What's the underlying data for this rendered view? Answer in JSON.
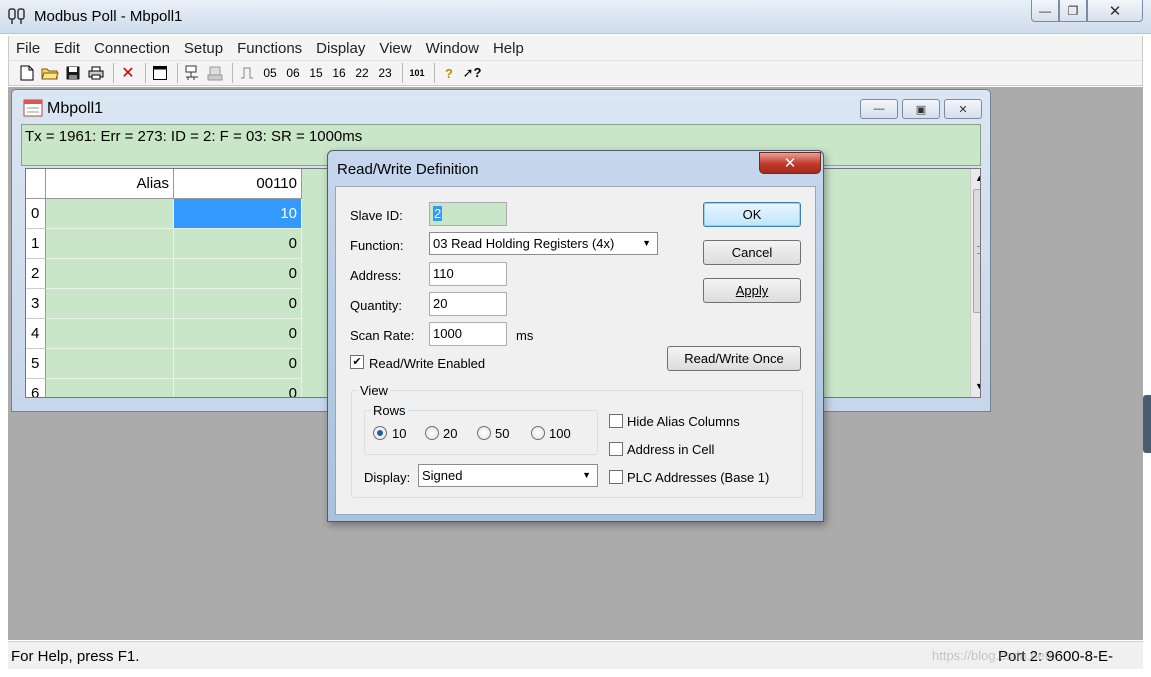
{
  "app": {
    "title": "Modbus Poll - Mbpoll1",
    "colors": {
      "grid_bg": "#c9e6c9",
      "selection": "#3399ff",
      "mdi_bg": "#ababab",
      "close_red": "#c0392b"
    }
  },
  "menu": [
    "File",
    "Edit",
    "Connection",
    "Setup",
    "Functions",
    "Display",
    "View",
    "Window",
    "Help"
  ],
  "toolbar": {
    "icons": [
      "new-file-icon",
      "open-folder-icon",
      "save-icon",
      "print-icon",
      "delete-icon",
      "window-icon",
      "connect-icon",
      "disconnect-icon",
      "pulse-icon"
    ],
    "functions": [
      "05",
      "06",
      "15",
      "16",
      "22",
      "23"
    ],
    "code": "101"
  },
  "child": {
    "title": "Mbpoll1",
    "status": "Tx = 1961: Err = 273: ID = 2: F = 03: SR = 1000ms",
    "columns": [
      "Alias",
      "00110"
    ],
    "rows": [
      {
        "idx": "0",
        "value": "10"
      },
      {
        "idx": "1",
        "value": "0"
      },
      {
        "idx": "2",
        "value": "0"
      },
      {
        "idx": "3",
        "value": "0"
      },
      {
        "idx": "4",
        "value": "0"
      },
      {
        "idx": "5",
        "value": "0"
      },
      {
        "idx": "6",
        "value": "0"
      }
    ]
  },
  "dialog": {
    "title": "Read/Write Definition",
    "slave_id_label": "Slave ID:",
    "slave_id": "2",
    "function_label": "Function:",
    "function": "03 Read Holding Registers (4x)",
    "address_label": "Address:",
    "address": "110",
    "quantity_label": "Quantity:",
    "quantity": "20",
    "scan_rate_label": "Scan Rate:",
    "scan_rate": "1000",
    "ms": "ms",
    "rw_enabled_label": "Read/Write Enabled",
    "rw_enabled": true,
    "ok": "OK",
    "cancel": "Cancel",
    "apply": "Apply",
    "rw_once": "Read/Write Once",
    "view": {
      "title": "View",
      "rows_title": "Rows",
      "rows_options": [
        "10",
        "20",
        "50",
        "100"
      ],
      "rows_selected": "10",
      "hide_alias": "Hide Alias Columns",
      "address_in_cell": "Address in Cell",
      "plc_addresses": "PLC Addresses (Base 1)",
      "display_label": "Display:",
      "display": "Signed"
    }
  },
  "status": {
    "help": "For Help, press F1.",
    "port": "Port 2: 9600-8-E-"
  },
  "watermark": "https://blog.csdn.net/..."
}
